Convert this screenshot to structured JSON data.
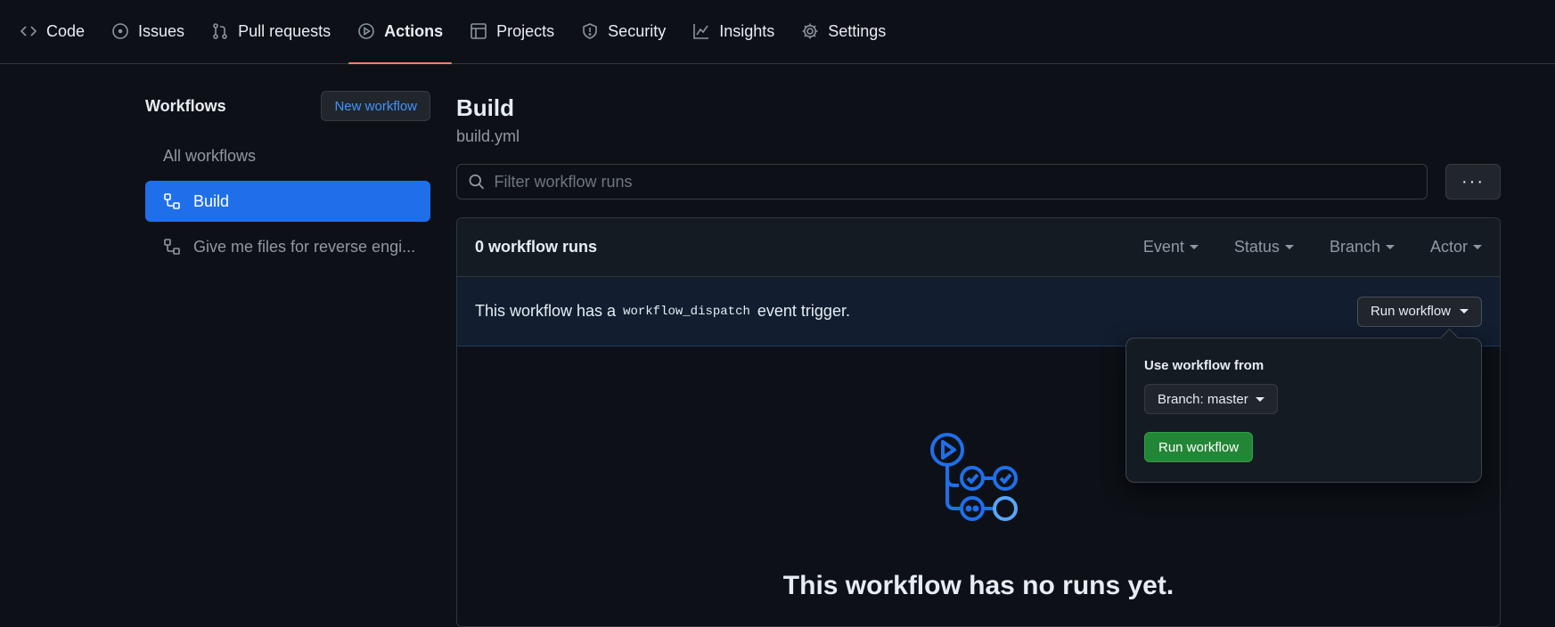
{
  "nav": {
    "tabs": [
      {
        "label": "Code",
        "icon": "code-icon"
      },
      {
        "label": "Issues",
        "icon": "issue-opened-icon"
      },
      {
        "label": "Pull requests",
        "icon": "git-pull-request-icon"
      },
      {
        "label": "Actions",
        "icon": "play-icon",
        "active": true
      },
      {
        "label": "Projects",
        "icon": "table-icon"
      },
      {
        "label": "Security",
        "icon": "shield-icon"
      },
      {
        "label": "Insights",
        "icon": "graph-icon"
      },
      {
        "label": "Settings",
        "icon": "gear-icon"
      }
    ],
    "active_underline_color": "#f78166"
  },
  "sidebar": {
    "title": "Workflows",
    "new_workflow_label": "New workflow",
    "items": [
      {
        "label": "All workflows"
      },
      {
        "label": "Build",
        "icon": "workflow-icon",
        "selected": true
      },
      {
        "label": "Give me files for reverse engi...",
        "icon": "workflow-icon"
      }
    ]
  },
  "main": {
    "title": "Build",
    "filename": "build.yml",
    "filter_placeholder": "Filter workflow runs",
    "more_label": "···",
    "runs_count": "0 workflow runs",
    "filters": [
      "Event",
      "Status",
      "Branch",
      "Actor"
    ],
    "dispatch": {
      "prefix": "This workflow has a",
      "code": "workflow_dispatch",
      "suffix": "event trigger.",
      "run_button": "Run workflow"
    },
    "empty_title": "This workflow has no runs yet."
  },
  "dropdown": {
    "label": "Use workflow from",
    "branch_button": "Branch: master",
    "run_button": "Run workflow"
  },
  "colors": {
    "accent": "#1f6feb",
    "link": "#4493f8",
    "success": "#238636",
    "background": "#0d1117"
  }
}
